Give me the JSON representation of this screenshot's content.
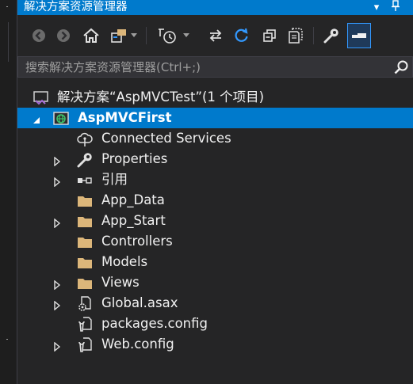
{
  "window": {
    "title": "解决方案资源管理器",
    "pin_button": "⊥",
    "dropdown_button": "▾"
  },
  "search": {
    "placeholder": "搜索解决方案资源管理器(Ctrl+;)",
    "value": ""
  },
  "toolbar": {
    "icons": [
      "back-icon",
      "forward-icon",
      "home-icon",
      "switch-views-icon",
      "dropdown-icon",
      "pending-changes-filter-icon",
      "dropdown-icon",
      "sync-with-active-document-icon",
      "refresh-icon",
      "collapse-all-icon",
      "show-all-files-icon",
      "properties-wrench-icon",
      "preview-selected-items-icon"
    ]
  },
  "tree": {
    "solution": "解决方案“AspMVCTest”(1 个项目)",
    "project": "AspMVCFirst",
    "items": [
      {
        "label": "Connected Services",
        "icon": "connected-services-icon",
        "expandable": false
      },
      {
        "label": "Properties",
        "icon": "wrench-icon",
        "expandable": true
      },
      {
        "label": "引用",
        "icon": "references-icon",
        "expandable": true
      },
      {
        "label": "App_Data",
        "icon": "folder-icon",
        "expandable": false
      },
      {
        "label": "App_Start",
        "icon": "folder-icon",
        "expandable": true
      },
      {
        "label": "Controllers",
        "icon": "folder-icon",
        "expandable": false
      },
      {
        "label": "Models",
        "icon": "folder-icon",
        "expandable": false
      },
      {
        "label": "Views",
        "icon": "folder-icon",
        "expandable": true
      },
      {
        "label": "Global.asax",
        "icon": "global-asax-icon",
        "expandable": true
      },
      {
        "label": "packages.config",
        "icon": "config-file-icon",
        "expandable": false
      },
      {
        "label": "Web.config",
        "icon": "config-file-icon",
        "expandable": true
      }
    ]
  },
  "colors": {
    "accent": "#007acc",
    "background": "#252526",
    "folder": "#dcb67a",
    "text": "#f1f1f1"
  }
}
